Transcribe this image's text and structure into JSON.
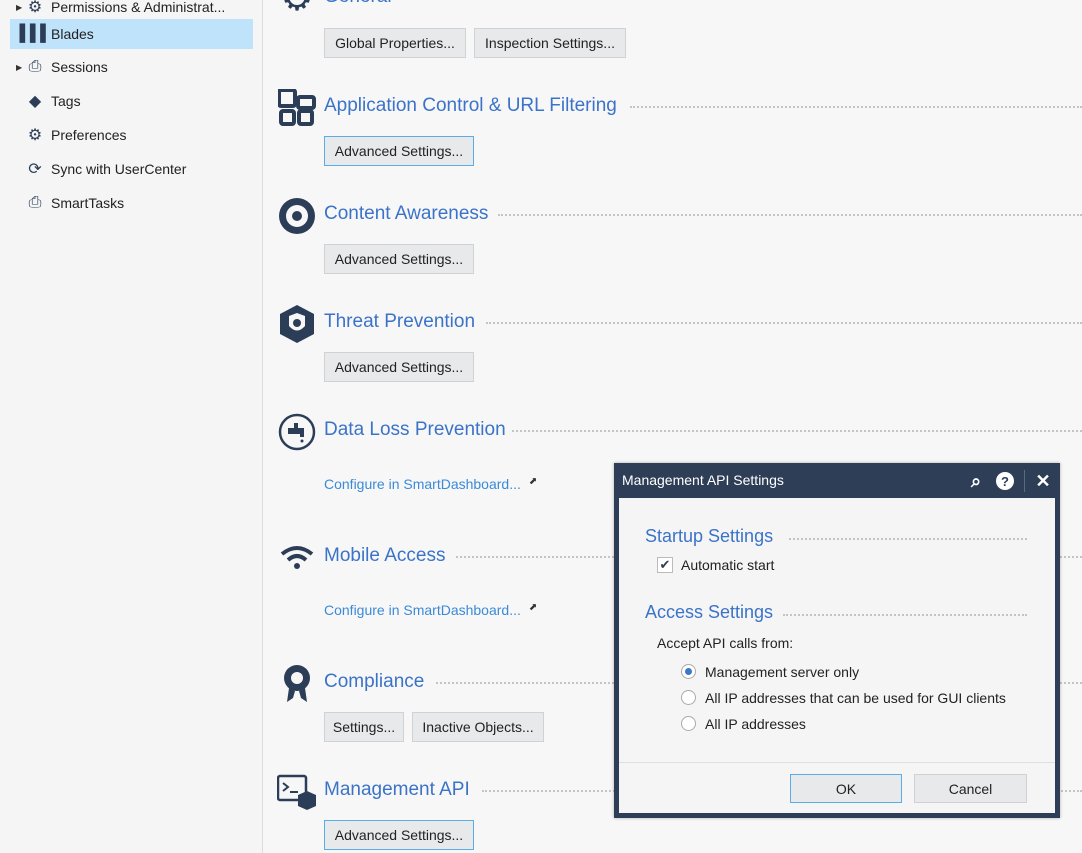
{
  "sidebar": {
    "items": [
      {
        "label": "Permissions & Administrat...",
        "icon": "gear-icon",
        "expandable": true
      },
      {
        "label": "Blades",
        "icon": "blades-icon",
        "selected": true
      },
      {
        "label": "Sessions",
        "icon": "sessions-icon",
        "expandable": true
      },
      {
        "label": "Tags",
        "icon": "tag-icon"
      },
      {
        "label": "Preferences",
        "icon": "gear-icon"
      },
      {
        "label": "Sync with UserCenter",
        "icon": "sync-icon"
      },
      {
        "label": "SmartTasks",
        "icon": "smarttasks-icon"
      }
    ]
  },
  "sections": [
    {
      "title": "General",
      "buttons": [
        "Global Properties...",
        "Inspection Settings..."
      ]
    },
    {
      "title": "Application Control & URL Filtering",
      "buttons": [
        "Advanced Settings..."
      ]
    },
    {
      "title": "Content Awareness",
      "buttons": [
        "Advanced Settings..."
      ]
    },
    {
      "title": "Threat Prevention",
      "buttons": [
        "Advanced Settings..."
      ]
    },
    {
      "title": "Data Loss Prevention",
      "link": "Configure in SmartDashboard..."
    },
    {
      "title": "Mobile Access",
      "link": "Configure in SmartDashboard..."
    },
    {
      "title": "Compliance",
      "buttons": [
        "Settings...",
        "Inactive Objects..."
      ]
    },
    {
      "title": "Management API",
      "buttons": [
        "Advanced Settings..."
      ]
    }
  ],
  "dialog": {
    "title": "Management API Settings",
    "startup_heading": "Startup Settings",
    "automatic_start": {
      "label": "Automatic start",
      "checked": true
    },
    "access_heading": "Access Settings",
    "accept_label": "Accept API calls from:",
    "options": [
      "Management server only",
      "All IP addresses that can be used for GUI clients",
      "All IP addresses"
    ],
    "selected_option": 0,
    "ok": "OK",
    "cancel": "Cancel"
  },
  "colors": {
    "accent": "#3b73c8",
    "titlebar": "#2e3e57",
    "selection": "#bfe3fb"
  }
}
